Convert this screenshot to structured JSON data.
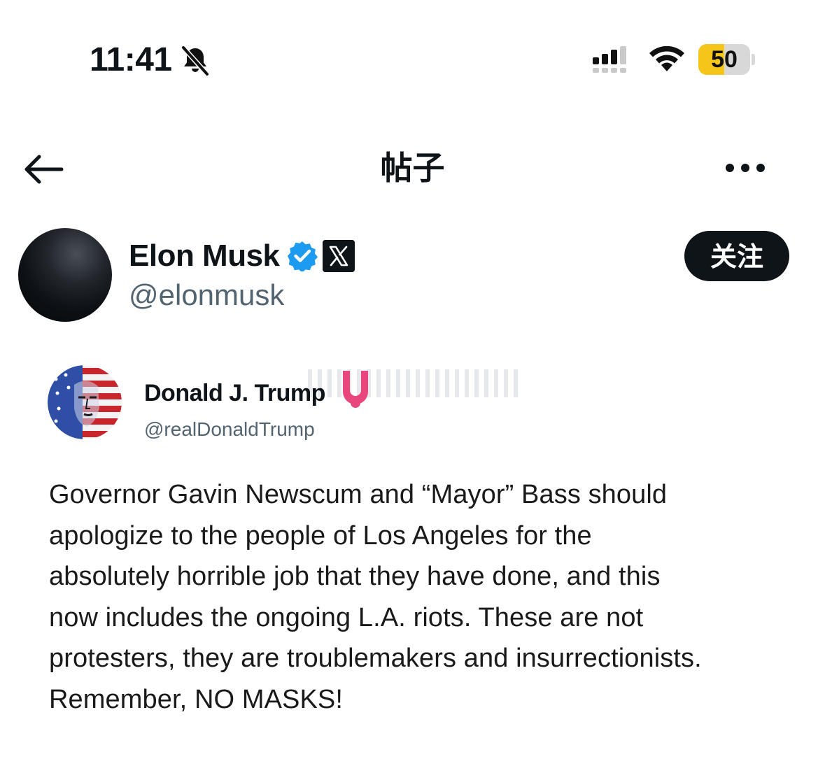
{
  "status_bar": {
    "time": "11:41",
    "battery": "50",
    "battery_level": 0.5,
    "battery_color": "#f5c518",
    "icons": [
      "bell-slash-icon",
      "signal-icon",
      "wifi-icon",
      "battery-icon"
    ]
  },
  "nav": {
    "title": "帖子",
    "back_icon": "back-arrow-icon",
    "more_icon": "more-icon"
  },
  "author": {
    "name": "Elon Musk",
    "handle": "@elonmusk",
    "verified_color": "#1d9bf0",
    "follow_label": "关注"
  },
  "quoted": {
    "name": "Donald J. Trump",
    "handle": "@realDonaldTrump",
    "badge_color": "#e8467c"
  },
  "post": {
    "lines": [
      "Governor Gavin Newscum and “Mayor” Bass should",
      "apologize to the people of Los Angeles for the",
      "absolutely horrible job that they have done, and this",
      "now includes the ongoing L.A. riots. These are not",
      "protesters, they are troublemakers and insurrectionists.",
      "Remember, NO MASKS!"
    ]
  }
}
